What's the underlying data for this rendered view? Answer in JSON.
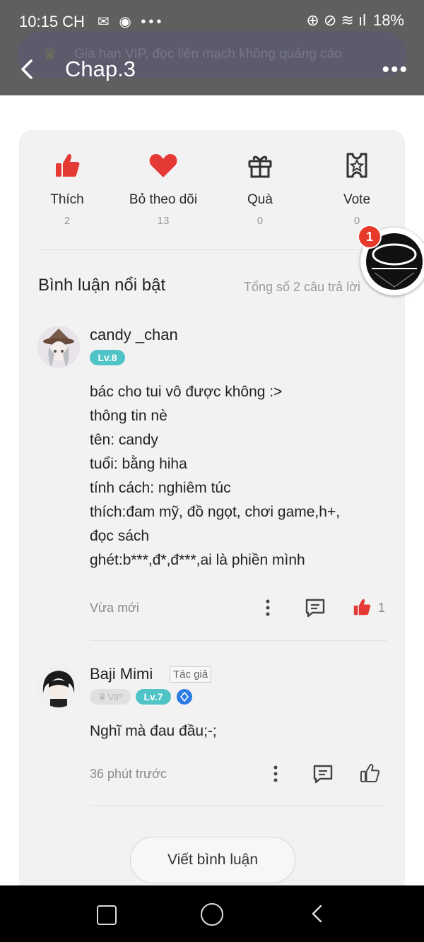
{
  "status_bar": {
    "time": "10:15 CH",
    "battery": "18%"
  },
  "banner": {
    "text": "Gia hạn VIP, đọc liền mạch không quảng cáo"
  },
  "header": {
    "title": "Chap.3"
  },
  "actions": [
    {
      "label": "Thích",
      "count": "2"
    },
    {
      "label": "Bỏ theo dõi",
      "count": "13"
    },
    {
      "label": "Quà",
      "count": "0"
    },
    {
      "label": "Vote",
      "count": "0"
    }
  ],
  "floating_badge": {
    "count": "1"
  },
  "comments_section": {
    "title": "Bình luận nổi bật",
    "total": "Tổng số 2 câu trả lời"
  },
  "comments": [
    {
      "user": "candy _chan",
      "level": "Lv.8",
      "lines": [
        "bác cho tui vô được không :>",
        "thông tin nè",
        "tên: candy",
        "tuổi: bằng hiha",
        "tính cách: nghiêm túc",
        "thích:đam mỹ, đồ ngọt, chơi game,h+,",
        "đọc sách",
        "ghét:b***,đ*,đ***,ai là phiền mình"
      ],
      "time": "Vừa mới",
      "likes": "1"
    },
    {
      "user": "Baji Mimi",
      "tag": "Tác giả",
      "vip": "VIP",
      "level": "Lv.7",
      "lines": [
        "Nghĩ mà đau đầu;-;"
      ],
      "time": "36 phút trước"
    }
  ],
  "write_button": "Viết bình luận",
  "colors": {
    "accent_red": "#e53935",
    "level_badge": "#4fc3c6",
    "top_bar": "#5f5f5f",
    "card_bg": "#f2f2f2"
  }
}
